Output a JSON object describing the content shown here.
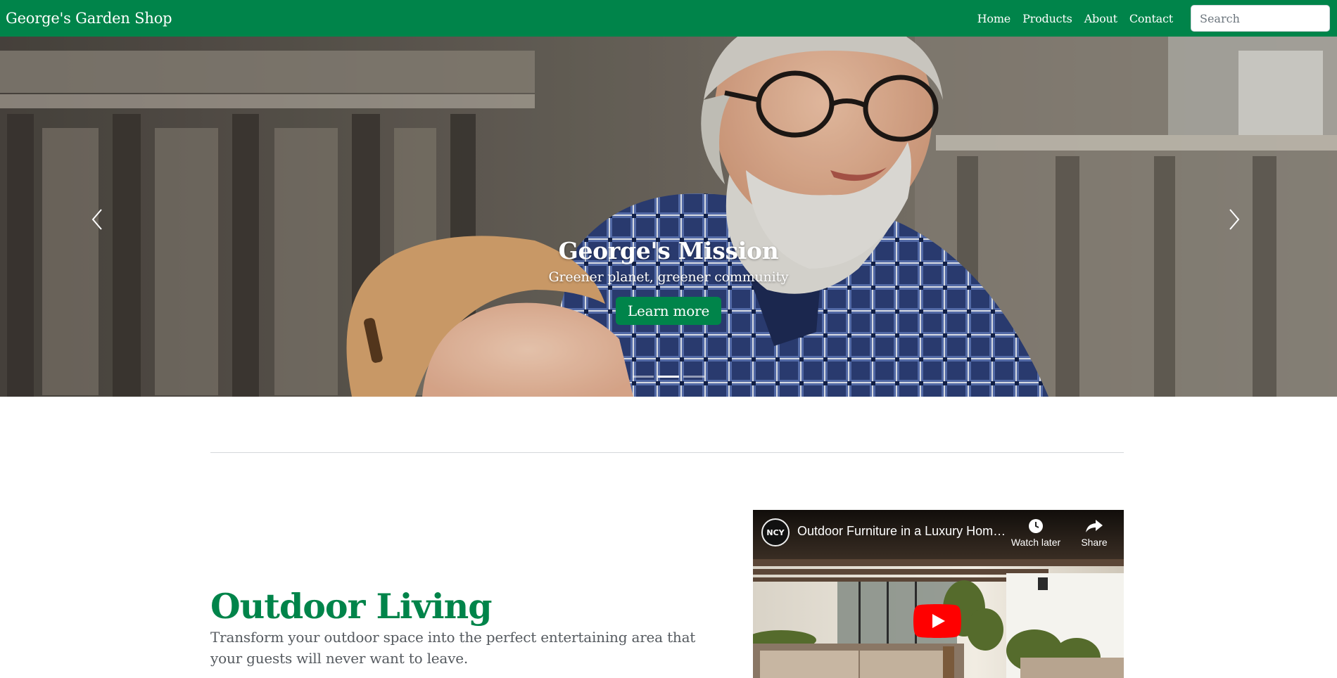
{
  "navbar": {
    "brand": "George's Garden Shop",
    "links": [
      "Home",
      "Products",
      "About",
      "Contact"
    ],
    "search_placeholder": "Search",
    "bg_color": "#00844a"
  },
  "hero": {
    "title": "George's Mission",
    "subtitle": "Greener planet, greener community",
    "button_label": "Learn more",
    "slides_count": 3,
    "active_slide": 2,
    "prev_icon": "chevron-left-icon",
    "next_icon": "chevron-right-icon"
  },
  "feature": {
    "title": "Outdoor Living",
    "text": "Transform your outdoor space into the perfect entertaining area that your guests will never want to leave."
  },
  "video": {
    "title": "Outdoor Furniture in a Luxury Hom…",
    "channel_initials": "NCY",
    "watch_later_label": "Watch later",
    "share_label": "Share",
    "play_icon": "youtube-play-icon"
  },
  "colors": {
    "brand_green": "#00844a",
    "youtube_red": "#ff0000"
  }
}
